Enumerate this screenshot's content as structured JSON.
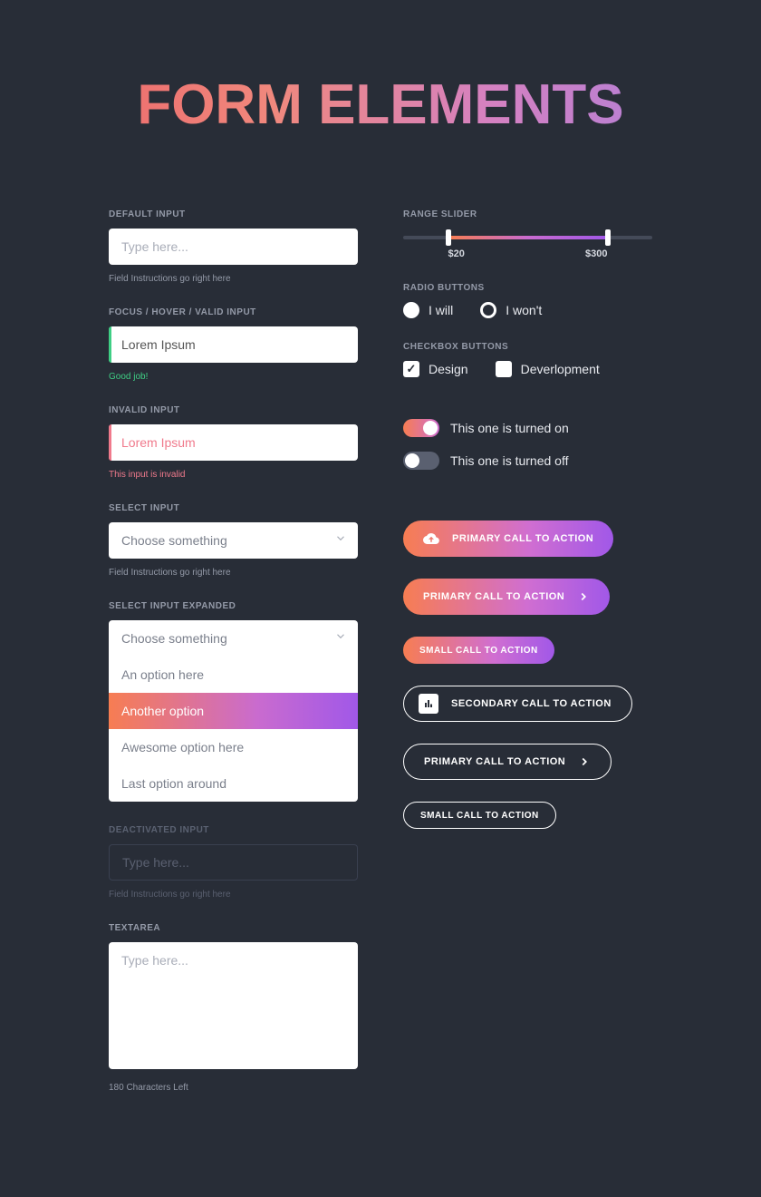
{
  "title": "FORM ELEMENTS",
  "left": {
    "default": {
      "label": "DEFAULT INPUT",
      "placeholder": "Type here...",
      "hint": "Field Instructions go right here"
    },
    "valid": {
      "label": "FOCUS / HOVER / VALID INPUT",
      "value": "Lorem Ipsum",
      "hint": "Good job!"
    },
    "invalid": {
      "label": "INVALID INPUT",
      "value": "Lorem Ipsum",
      "hint": "This input is invalid"
    },
    "select": {
      "label": "SELECT INPUT",
      "value": "Choose something",
      "hint": "Field Instructions go right here"
    },
    "selectExpanded": {
      "label": "SELECT INPUT EXPANDED",
      "value": "Choose something",
      "options": [
        "An option here",
        "Another option",
        "Awesome option here",
        "Last option around"
      ],
      "activeIndex": 1
    },
    "deactivated": {
      "label": "DEACTIVATED INPUT",
      "placeholder": "Type here...",
      "hint": "Field Instructions go right here"
    },
    "textarea": {
      "label": "TEXTAREA",
      "placeholder": "Type here...",
      "hint": "180 Characters Left"
    }
  },
  "right": {
    "slider": {
      "label": "RANGE SLIDER",
      "min": "$20",
      "max": "$300"
    },
    "radio": {
      "label": "RADIO BUTTONS",
      "opt1": "I will",
      "opt2": "I won't"
    },
    "checkbox": {
      "label": "CHECKBOX BUTTONS",
      "opt1": "Design",
      "opt2": "Deverlopment"
    },
    "toggleOn": "This one is turned on",
    "toggleOff": "This one is turned off",
    "buttons": {
      "primary1": "PRIMARY CALL TO ACTION",
      "primary2": "PRIMARY CALL TO ACTION",
      "small1": "SMALL CALL TO ACTION",
      "secondary": "SECONDARY CALL TO ACTION",
      "primary3": "PRIMARY CALL TO ACTION",
      "small2": "SMALL CALL TO ACTION"
    }
  }
}
